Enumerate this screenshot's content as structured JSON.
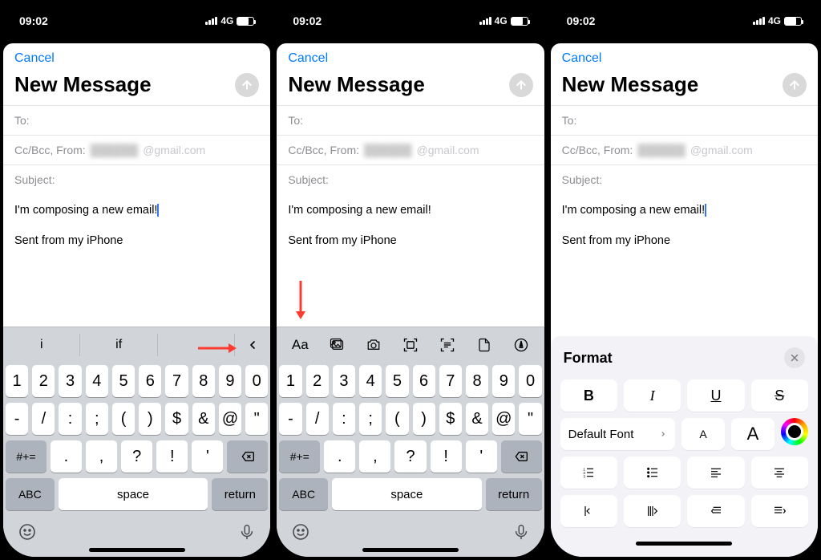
{
  "status": {
    "time": "09:02",
    "net": "4G"
  },
  "compose": {
    "cancel": "Cancel",
    "title": "New Message",
    "to_label": "To:",
    "ccbcc_label": "Cc/Bcc, From:",
    "from_masked": "██████",
    "from_domain": "@gmail.com",
    "subject_label": "Subject:",
    "body_line1": "I'm composing a new email!",
    "body_sig": "Sent from my iPhone"
  },
  "suggest": {
    "s1": "i",
    "s2": "if",
    "s3": ""
  },
  "toolbar_icons": [
    "Aa",
    "photos",
    "camera",
    "scan-doc",
    "scan-text",
    "file",
    "markup"
  ],
  "kbd": {
    "row1": [
      "1",
      "2",
      "3",
      "4",
      "5",
      "6",
      "7",
      "8",
      "9",
      "0"
    ],
    "row2": [
      "-",
      "/",
      ":",
      ";",
      "(",
      ")",
      "$",
      "&",
      "@",
      "\""
    ],
    "row3_switch": "#+=",
    "row3": [
      ".",
      ",",
      "?",
      "!",
      "'"
    ],
    "abc": "ABC",
    "space": "space",
    "ret": "return"
  },
  "format": {
    "title": "Format",
    "bold": "B",
    "italic": "I",
    "underline": "U",
    "strike": "S",
    "default_font": "Default Font",
    "size_small": "A",
    "size_large": "A"
  }
}
